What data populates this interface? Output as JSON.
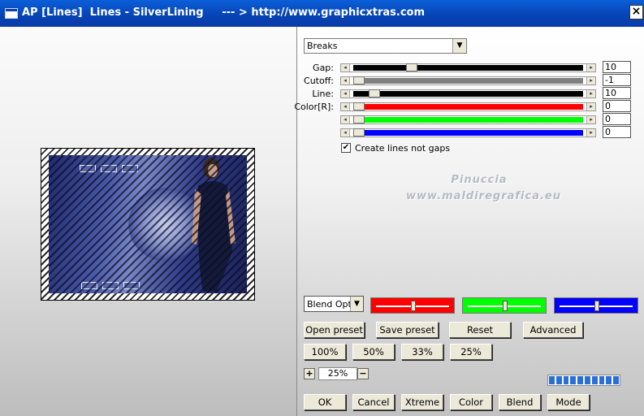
{
  "window": {
    "title": "AP [Lines]  Lines - SilverLining     --- > http://www.graphicxtras.com",
    "close_label": "×"
  },
  "preset_dropdown": {
    "value": "Breaks"
  },
  "sliders": [
    {
      "label": "Gap:",
      "value": "10",
      "position": 0.24,
      "fill": "#000000"
    },
    {
      "label": "Cutoff:",
      "value": "-1",
      "position": 0.0,
      "fill": "#808080"
    },
    {
      "label": "Line:",
      "value": "10",
      "position": 0.07,
      "fill": "#000000"
    },
    {
      "label": "Color[R]:",
      "value": "0",
      "position": 0.0,
      "fill": "#ff0000"
    },
    {
      "label": "",
      "value": "0",
      "position": 0.0,
      "fill": "#00ff00"
    },
    {
      "label": "",
      "value": "0",
      "position": 0.0,
      "fill": "#0000ff"
    }
  ],
  "checkbox": {
    "label": "Create lines not gaps",
    "checked": true,
    "mark": "✔"
  },
  "watermark": {
    "line1": "Pinuccia",
    "line2": "www.maldiregrafica.eu"
  },
  "blend": {
    "value": "Blend Options"
  },
  "color_swatches": [
    {
      "color": "#ff0000",
      "knob": 0.5
    },
    {
      "color": "#00ff00",
      "knob": 0.5
    },
    {
      "color": "#0000ff",
      "knob": 0.5
    }
  ],
  "preset_buttons": [
    "Open preset",
    "Save preset",
    "Reset",
    "Advanced"
  ],
  "zoom_buttons": [
    "100%",
    "50%",
    "33%",
    "25%"
  ],
  "zoom": {
    "plus": "+",
    "minus": "−",
    "value": "25%"
  },
  "progress": {
    "segments": 10
  },
  "bottom_buttons": [
    "OK",
    "Cancel",
    "Xtreme",
    "Color",
    "Blend",
    "Mode"
  ]
}
